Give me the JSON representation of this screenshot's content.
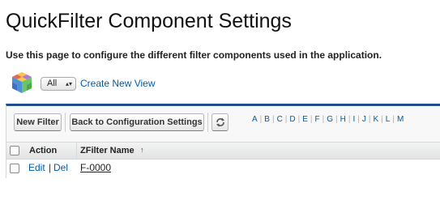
{
  "page": {
    "title": "QuickFilter Component Settings",
    "description": "Use this page to configure the different filter components used in the application."
  },
  "view": {
    "selected": "All",
    "create_link": "Create New View"
  },
  "toolbar": {
    "new_filter": "New Filter",
    "back": "Back to Configuration Settings",
    "refresh_icon": "refresh-icon"
  },
  "alphabet": [
    "A",
    "B",
    "C",
    "D",
    "E",
    "F",
    "G",
    "H",
    "I",
    "J",
    "K",
    "L",
    "M"
  ],
  "table": {
    "headers": {
      "action": "Action",
      "name": "ZFilter Name",
      "sort_indicator": "↑"
    },
    "rows": [
      {
        "edit": "Edit",
        "separator": "|",
        "del": "Del",
        "name": "F-0000"
      }
    ]
  },
  "colors": {
    "link": "#015ba7",
    "panel_accent": "#1f4e8c"
  }
}
